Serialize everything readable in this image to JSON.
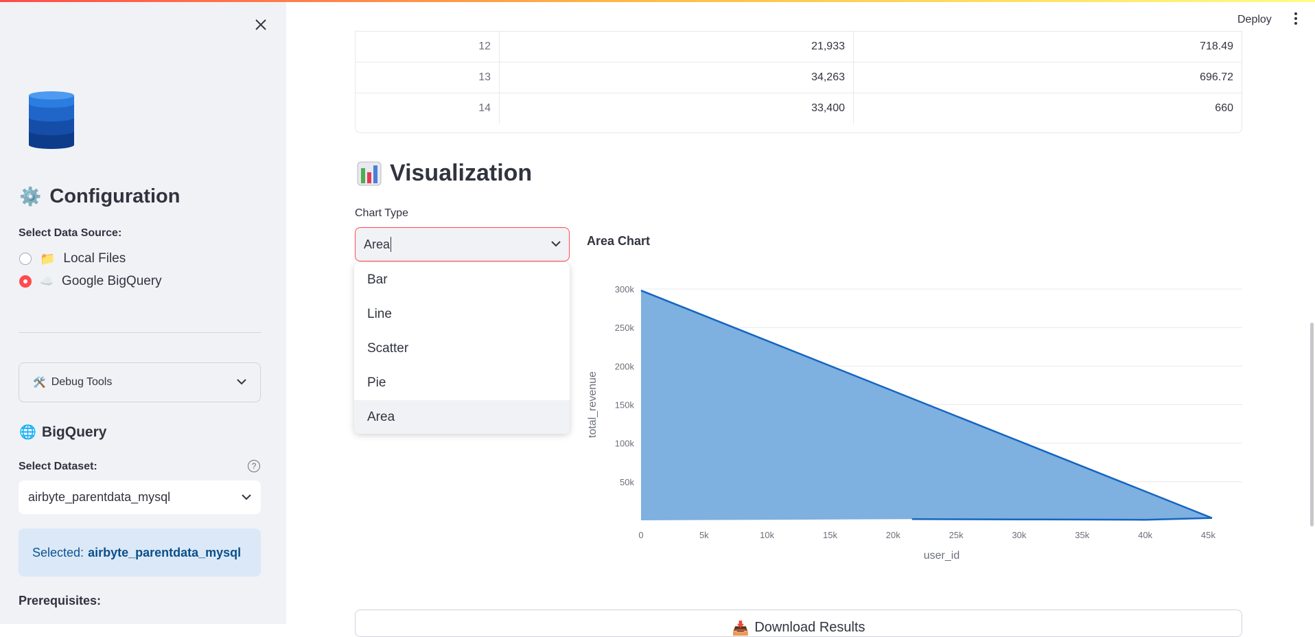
{
  "sidebar": {
    "configuration_title": "Configuration",
    "data_source_label": "Select Data Source:",
    "data_sources": [
      {
        "label": "Local Files",
        "selected": false
      },
      {
        "label": "Google BigQuery",
        "selected": true
      }
    ],
    "debug_tools_label": "Debug Tools",
    "bigquery_title": "BigQuery",
    "dataset_label": "Select Dataset:",
    "dataset_value": "airbyte_parentdata_mysql",
    "selected_prefix": "Selected:",
    "selected_value": "airbyte_parentdata_mysql",
    "prerequisites_label": "Prerequisites:"
  },
  "header": {
    "deploy_label": "Deploy"
  },
  "table": {
    "rows": [
      [
        "12",
        "21,933",
        "718.49"
      ],
      [
        "13",
        "34,263",
        "696.72"
      ],
      [
        "14",
        "33,400",
        "660"
      ]
    ]
  },
  "visualization": {
    "title": "Visualization",
    "chart_type_label": "Chart Type",
    "chart_type_value": "Area",
    "options": [
      "Bar",
      "Line",
      "Scatter",
      "Pie",
      "Area"
    ],
    "selected_option": "Area"
  },
  "download_label": "Download Results",
  "colors": {
    "accent": "#ff4b4b",
    "area_fill": "#7eb0e0",
    "area_line": "#1565c0",
    "info_bg": "#dbe8f7"
  },
  "chart_data": {
    "type": "area",
    "title": "Area Chart",
    "xlabel": "user_id",
    "ylabel": "total_revenue",
    "xlim": [
      0,
      45000
    ],
    "ylim": [
      0,
      300000
    ],
    "x_ticks": [
      "0",
      "5k",
      "10k",
      "15k",
      "20k",
      "25k",
      "30k",
      "35k",
      "40k",
      "45k"
    ],
    "y_ticks": [
      "50k",
      "100k",
      "150k",
      "200k",
      "250k",
      "300k"
    ],
    "points": [
      {
        "x": 0,
        "y": 298000
      },
      {
        "x": 45300,
        "y": 3000
      },
      {
        "x": 40000,
        "y": 700
      },
      {
        "x": 30000,
        "y": 1200
      },
      {
        "x": 21500,
        "y": 1500
      }
    ],
    "grid": true,
    "legend": "none"
  }
}
